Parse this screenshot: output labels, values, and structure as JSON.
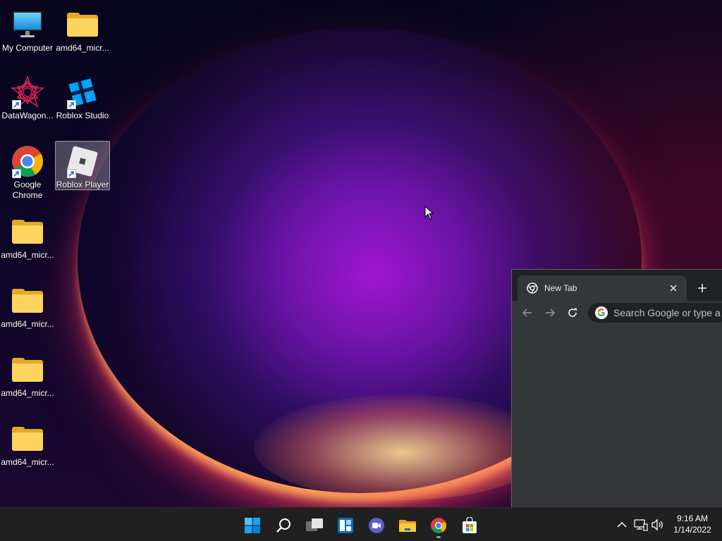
{
  "desktop": {
    "icons": [
      {
        "label": "My Computer",
        "icon": "monitor-icon",
        "shortcut": false,
        "selected": false
      },
      {
        "label": "amd64_micr...",
        "icon": "folder-icon",
        "shortcut": false,
        "selected": false
      },
      {
        "label": "DataWagon...",
        "icon": "datawagon-icon",
        "shortcut": true,
        "selected": false
      },
      {
        "label": "Roblox Studio",
        "icon": "roblox-studio-icon",
        "shortcut": true,
        "selected": false
      },
      {
        "label": "Google Chrome",
        "icon": "chrome-icon",
        "shortcut": true,
        "selected": false
      },
      {
        "label": "Roblox Player",
        "icon": "roblox-player-icon",
        "shortcut": true,
        "selected": true
      },
      {
        "label": "amd64_micr...",
        "icon": "folder-icon",
        "shortcut": false,
        "selected": false
      },
      {
        "label": "amd64_micr...",
        "icon": "folder-icon",
        "shortcut": false,
        "selected": false
      },
      {
        "label": "amd64_micr...",
        "icon": "folder-icon",
        "shortcut": false,
        "selected": false
      },
      {
        "label": "amd64_micr...",
        "icon": "folder-icon",
        "shortcut": false,
        "selected": false
      }
    ]
  },
  "browser": {
    "tab_title": "New Tab",
    "omnibox_placeholder": "Search Google or type a URL"
  },
  "taskbar": {
    "apps": [
      {
        "name": "Start",
        "icon": "windows-start-icon",
        "running": false
      },
      {
        "name": "Search",
        "icon": "search-icon",
        "running": false
      },
      {
        "name": "Task View",
        "icon": "task-view-icon",
        "running": false
      },
      {
        "name": "Widgets",
        "icon": "widgets-icon",
        "running": false
      },
      {
        "name": "Chat",
        "icon": "teams-chat-icon",
        "running": false
      },
      {
        "name": "File Explorer",
        "icon": "file-explorer-icon",
        "running": false
      },
      {
        "name": "Google Chrome",
        "icon": "chrome-icon",
        "running": true
      },
      {
        "name": "Microsoft Store",
        "icon": "store-icon",
        "running": false
      }
    ],
    "clock": {
      "time": "9:16 AM",
      "date": "1/14/2022"
    }
  },
  "colors": {
    "taskbar_bg": "#202020",
    "chrome_frame": "#202124",
    "chrome_toolbar": "#35363a",
    "folder_yellow": "#ffd45e",
    "windows_blue": "#0078d4",
    "selection_highlight": "rgba(255,255,255,0.26)"
  }
}
